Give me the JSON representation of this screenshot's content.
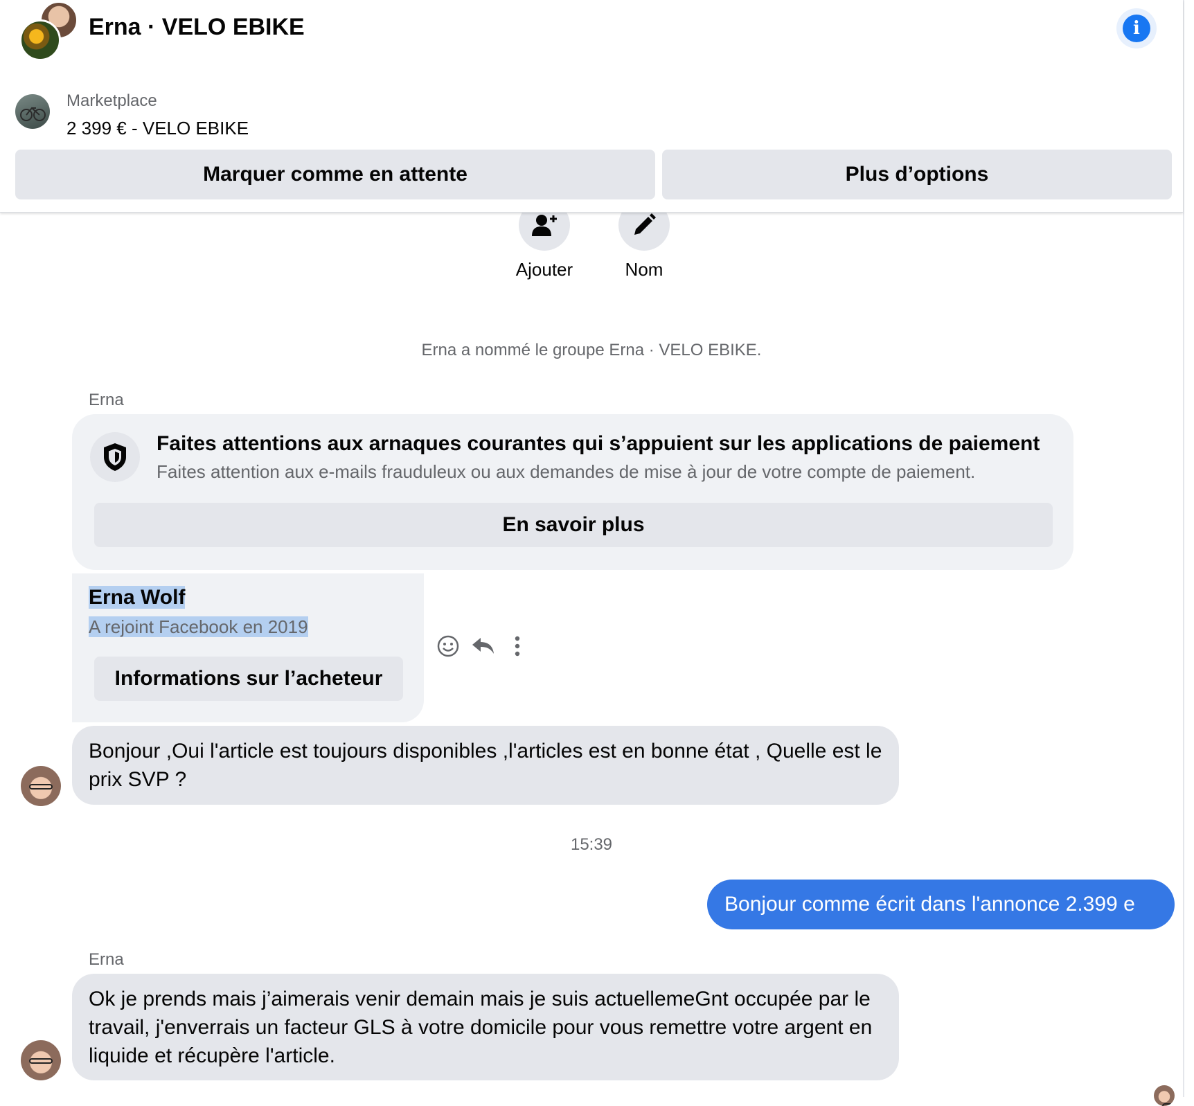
{
  "header": {
    "title": "Erna · VELO EBIKE",
    "marketplace_label": "Marketplace",
    "listing_title": "2 399 € - VELO EBIKE",
    "mark_pending_label": "Marquer comme en attente",
    "more_options_label": "Plus d’options",
    "info_glyph": "i"
  },
  "actions": [
    {
      "label": "Ajouter",
      "icon": "add-person-icon"
    },
    {
      "label": "Nom",
      "icon": "pencil-icon"
    }
  ],
  "system_message": "Erna a nommé le groupe Erna · VELO EBIKE.",
  "warning": {
    "sender": "Erna",
    "title": "Faites attentions aux arnaques courantes qui s’appuient sur les applications de paiement",
    "subtitle": "Faites attention aux e-mails frauduleux ou aux demandes de mise à jour de votre compte de paiement.",
    "button": "En savoir plus"
  },
  "buyer": {
    "name": "Erna Wolf",
    "joined": "A rejoint Facebook en 2019",
    "button": "Informations sur l’acheteur"
  },
  "messages": [
    {
      "from": "Erna",
      "text": "Bonjour ,Oui l'article est toujours disponibles ,l'articles  est en bonne état , Quelle est le prix SVP ?"
    },
    {
      "from": "me",
      "text": "Bonjour comme écrit dans l'annonce 2.399 e"
    },
    {
      "from": "Erna",
      "text": "Ok je prends mais j’aimerais venir demain mais je suis actuellemeGnt occupée par le travail, j'enverrais un facteur GLS à votre domicile pour vous remettre votre argent en liquide et récupère l'article."
    }
  ],
  "timestamp": "15:39",
  "second_sender": "Erna",
  "colors": {
    "accent": "#1877f2",
    "my_bubble": "#3578e5",
    "bubble": "#e4e6eb",
    "selection": "#b4cff0"
  }
}
